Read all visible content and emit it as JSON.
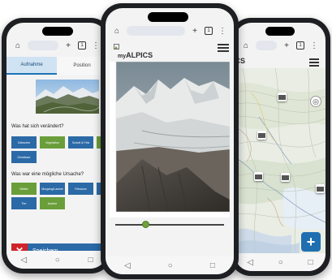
{
  "app": {
    "name": "myALPICS",
    "name_prefix": "my",
    "name_brand": "ALPICS",
    "brand_color": "#1f6fb0",
    "accent_green": "#6a9e3a",
    "danger_red": "#d0232a"
  },
  "browser": {
    "home_icon": "home-icon",
    "plus_label": "+",
    "tab_count": "1",
    "menu_icon": "more-vertical-icon"
  },
  "phone1": {
    "tabs": [
      {
        "label": "Aufnahme",
        "active": true
      },
      {
        "label": "Position",
        "active": false
      }
    ],
    "change_question": "Was hat sich verändert?",
    "change_options": [
      {
        "label": "Gletscher",
        "color": "blue"
      },
      {
        "label": "Vegetation",
        "color": "green"
      },
      {
        "label": "Schutt & Fels",
        "color": "blue"
      },
      {
        "label": "",
        "color": "green"
      },
      {
        "label": "Gewässer",
        "color": "blue"
      }
    ],
    "cause_question": "Was war eine mögliche Ursache?",
    "cause_options": [
      {
        "label": "Wetter",
        "color": "green"
      },
      {
        "label": "Murgang/Lawine",
        "color": "blue"
      },
      {
        "label": "Felssturz",
        "color": "blue"
      },
      {
        "label": "",
        "color": "blue"
      },
      {
        "label": "Tier",
        "color": "blue"
      },
      {
        "label": "Andere",
        "color": "green"
      }
    ],
    "save_label": "Speichern",
    "close_symbol": "✕"
  },
  "phone2": {
    "compare_slider_value": 0.26
  },
  "phone3": {
    "brand_fragment": "ICS",
    "fab_label": "+",
    "locate_icon": "locate-icon"
  }
}
